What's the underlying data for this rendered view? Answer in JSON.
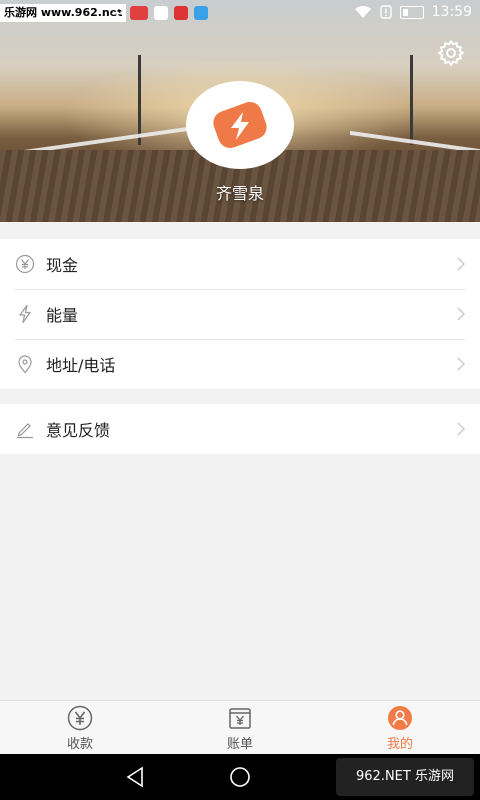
{
  "status_bar": {
    "watermark": "乐游网 www.962.net",
    "time": "13:59"
  },
  "profile": {
    "name": "齐雪泉"
  },
  "menu_primary": [
    {
      "label": "现金",
      "icon": "yuan-icon"
    },
    {
      "label": "能量",
      "icon": "lightning-icon"
    },
    {
      "label": "地址/电话",
      "icon": "location-pin-icon"
    }
  ],
  "menu_secondary": [
    {
      "label": "意见反馈",
      "icon": "pencil-icon"
    }
  ],
  "tabs": [
    {
      "label": "收款",
      "icon": "yuan-circle-icon",
      "active": false
    },
    {
      "label": "账单",
      "icon": "bill-icon",
      "active": false
    },
    {
      "label": "我的",
      "icon": "person-icon",
      "active": true
    }
  ],
  "colors": {
    "accent": "#f27a47",
    "logo": "#f07a47"
  },
  "brand_watermark": "962.NET 乐游网"
}
